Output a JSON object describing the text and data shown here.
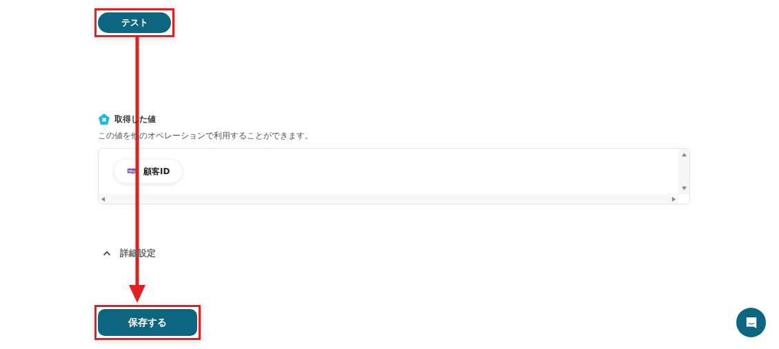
{
  "test_button": {
    "label": "テスト"
  },
  "output_section": {
    "title": "取得した値",
    "description": "この値を他のオペレーションで利用することができます。",
    "values": [
      {
        "label": "顧客ID"
      }
    ]
  },
  "advanced_settings": {
    "label": "詳細設定",
    "expanded": true
  },
  "save_button": {
    "label": "保存する"
  }
}
